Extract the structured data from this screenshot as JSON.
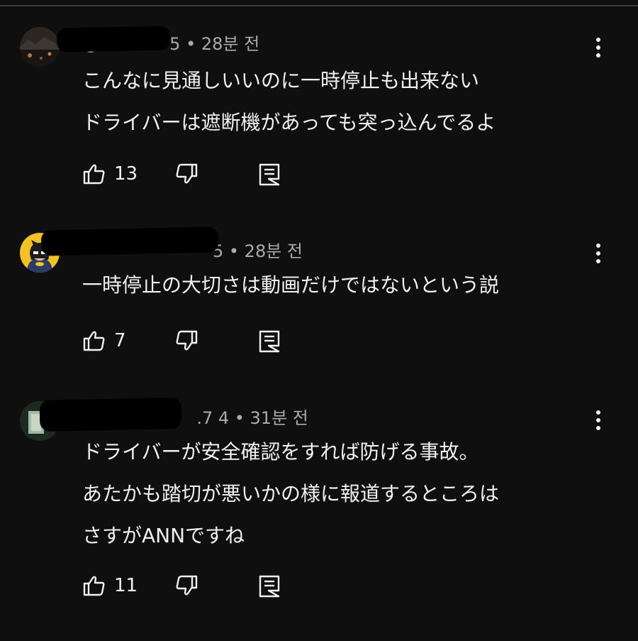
{
  "comments": [
    {
      "meta": "@             5 • 28분 전",
      "lines": [
        "こんなに見通しいいのに一時停止も出来ない",
        "ドライバーは遮断機があっても突っ込んでるよ"
      ],
      "likes": "13",
      "avatar_icon": "night-scene-avatar-icon"
    },
    {
      "meta": "5 • 28분 전",
      "lines": [
        "一時停止の大切さは動画だけではないという説"
      ],
      "likes": "7",
      "avatar_icon": "batman-avatar-icon"
    },
    {
      "meta": "@                  .7 4 • 31분 전",
      "lines": [
        "ドライバーが安全確認をすれば防げる事故。",
        "あたかも踏切が悪いかの様に報道するところは",
        "さすがANNですね"
      ],
      "likes": "11",
      "avatar_icon": "green-photo-avatar-icon"
    }
  ],
  "icons": {
    "like": "thumbs-up-icon",
    "dislike": "thumbs-down-icon",
    "reply": "reply-icon",
    "menu": "more-vert-icon"
  },
  "colors": {
    "background": "#0f0f0f",
    "text": "#f1f1f1",
    "meta": "#aaaaaa"
  }
}
